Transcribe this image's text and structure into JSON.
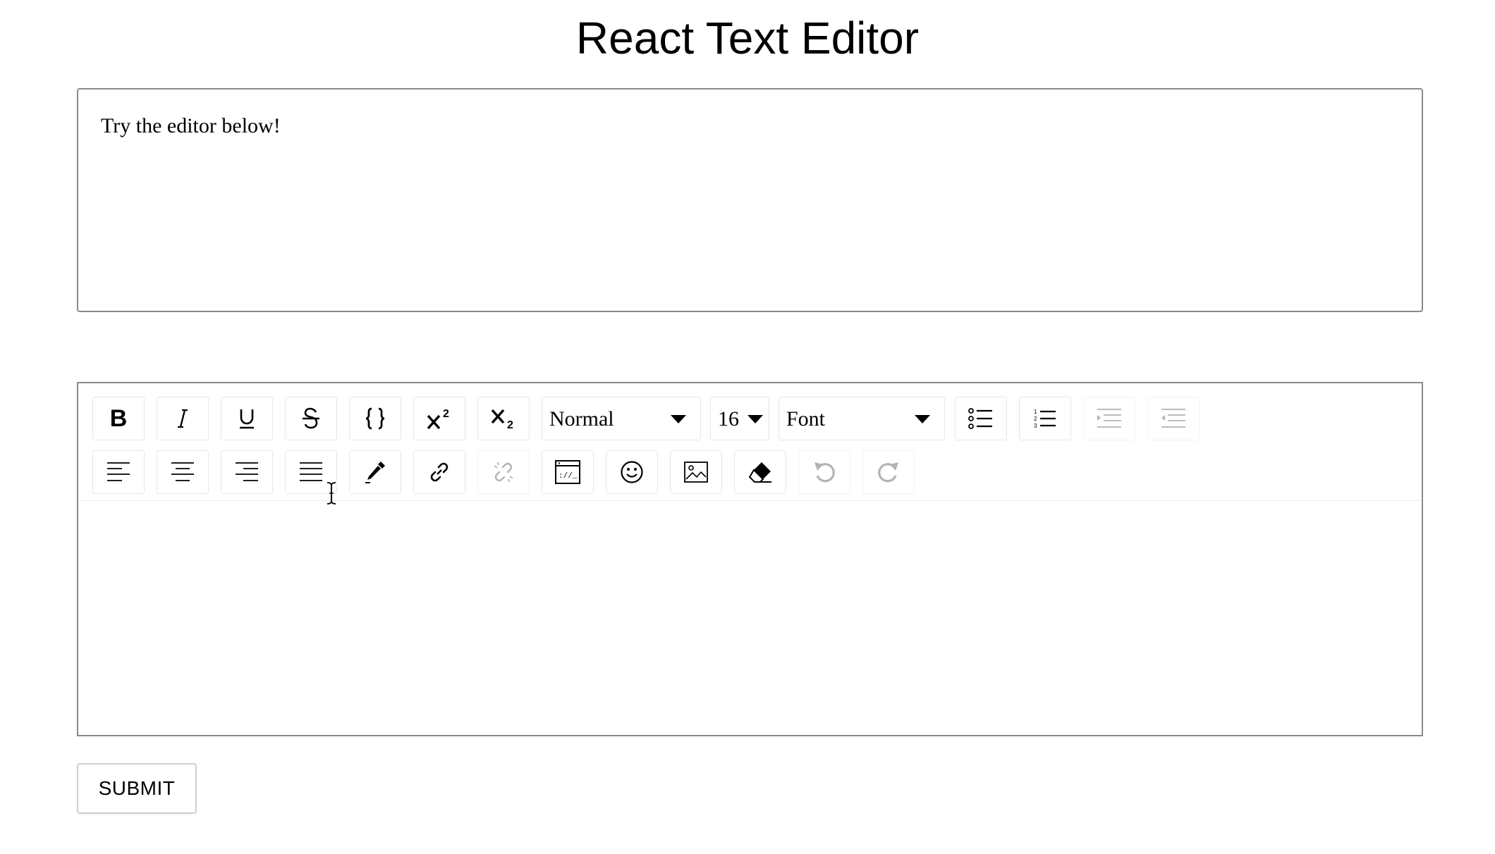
{
  "page": {
    "title": "React Text Editor"
  },
  "preview": {
    "text": "Try the editor below!"
  },
  "toolbar": {
    "row1": {
      "bold_label": "B",
      "block_type": {
        "selected": "Normal"
      },
      "font_size": {
        "selected": "16"
      },
      "font_family": {
        "selected": "Font"
      }
    },
    "icons_row1": [
      "bold-icon",
      "italic-icon",
      "underline-icon",
      "strikethrough-icon",
      "code-icon",
      "superscript-icon",
      "subscript-icon",
      "unordered-list-icon",
      "ordered-list-icon",
      "indent-icon",
      "outdent-icon"
    ],
    "icons_row2": [
      "align-left-icon",
      "align-center-icon",
      "align-right-icon",
      "align-justify-icon",
      "color-picker-icon",
      "link-icon",
      "unlink-icon",
      "embed-icon",
      "emoji-icon",
      "image-icon",
      "eraser-icon",
      "undo-icon",
      "redo-icon"
    ],
    "disabled": [
      "indent-icon",
      "outdent-icon",
      "unlink-icon",
      "undo-icon",
      "redo-icon"
    ]
  },
  "editor": {
    "content": ""
  },
  "submit": {
    "label": "SUBMIT"
  },
  "colors": {
    "border": "#8a8a8a",
    "button_border": "#e6e6e6",
    "disabled_icon": "#b3b3b3"
  }
}
